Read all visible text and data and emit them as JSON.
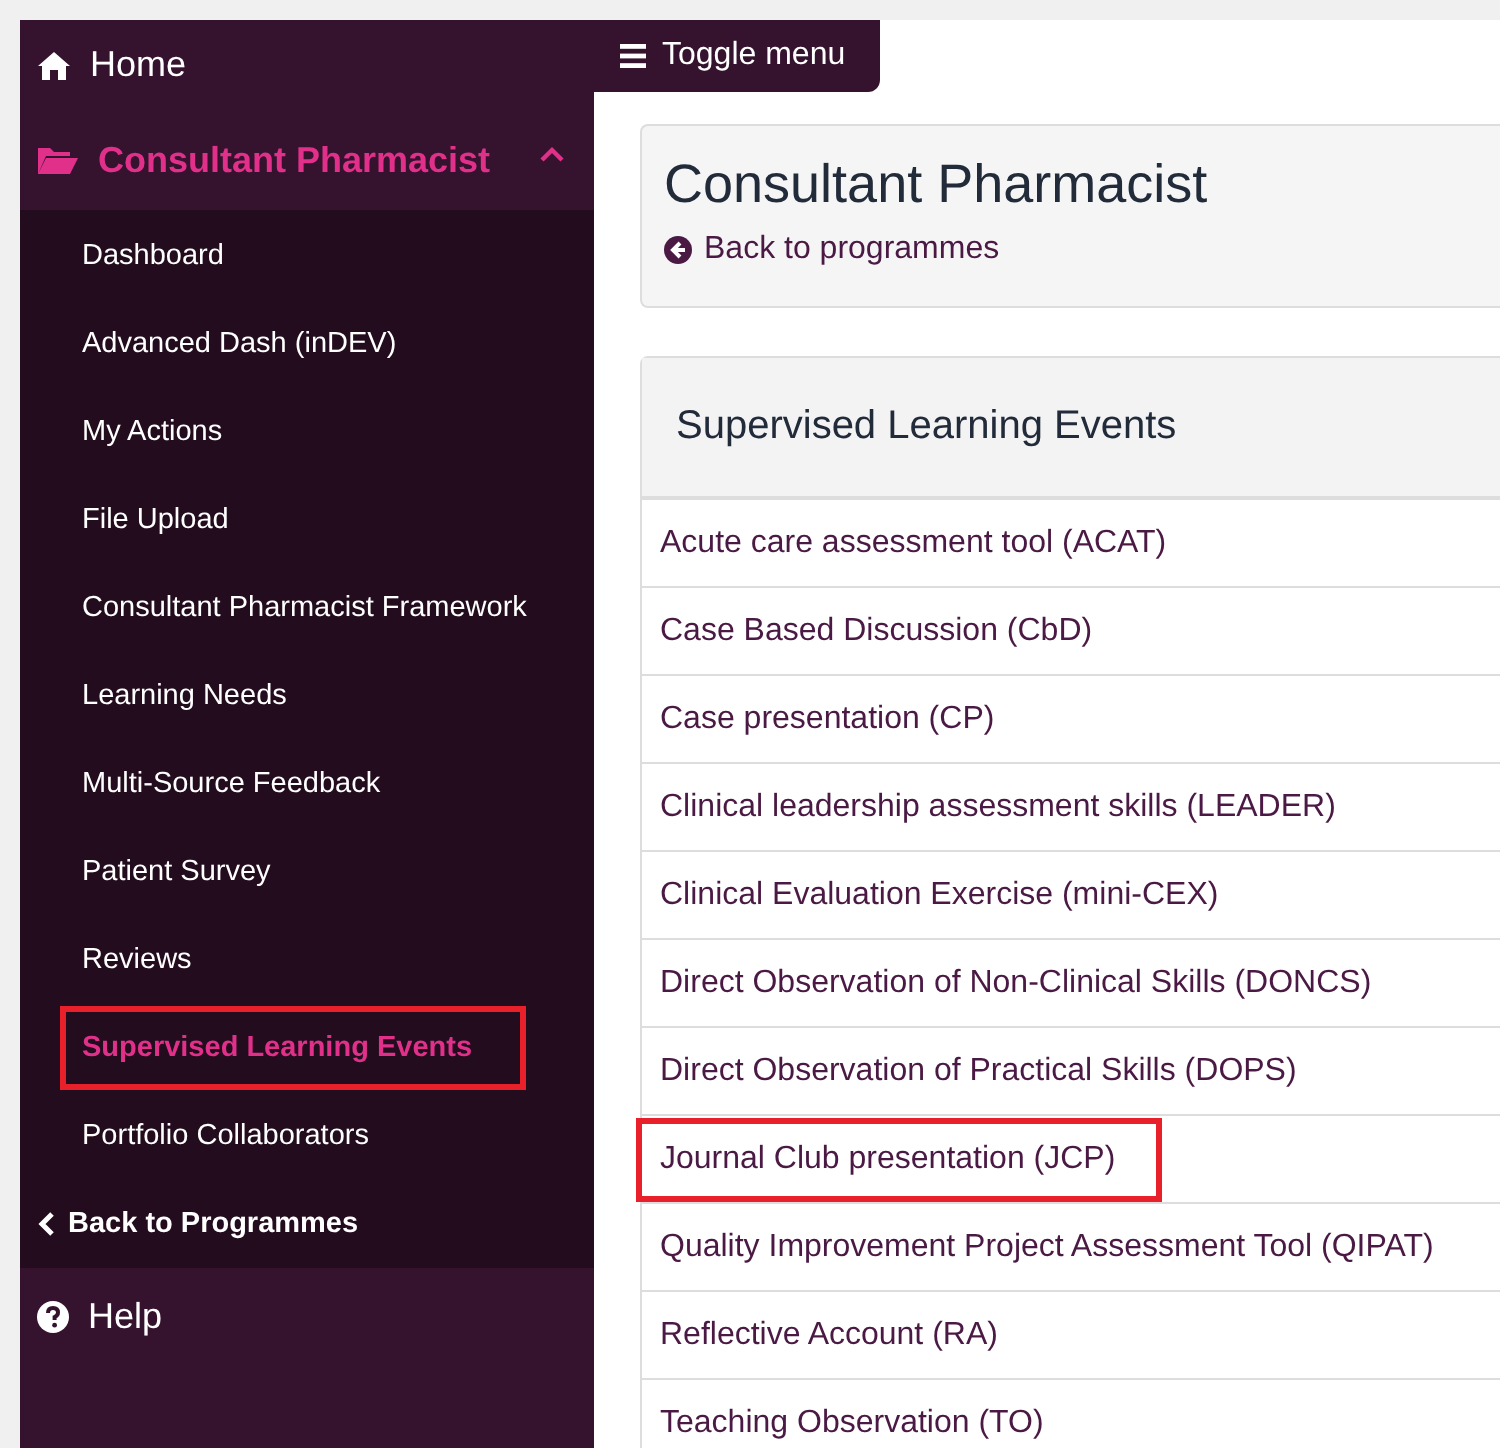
{
  "sidebar": {
    "home": {
      "label": "Home"
    },
    "section": {
      "label": "Consultant Pharmacist",
      "expanded": true
    },
    "items": [
      {
        "label": "Dashboard",
        "selected": false,
        "highlighted": false
      },
      {
        "label": "Advanced Dash (inDEV)",
        "selected": false,
        "highlighted": false
      },
      {
        "label": "My Actions",
        "selected": false,
        "highlighted": false
      },
      {
        "label": "File Upload",
        "selected": false,
        "highlighted": false
      },
      {
        "label": "Consultant Pharmacist Framework",
        "selected": false,
        "highlighted": false
      },
      {
        "label": "Learning Needs",
        "selected": false,
        "highlighted": false
      },
      {
        "label": "Multi-Source Feedback",
        "selected": false,
        "highlighted": false
      },
      {
        "label": "Patient Survey",
        "selected": false,
        "highlighted": false
      },
      {
        "label": "Reviews",
        "selected": false,
        "highlighted": false
      },
      {
        "label": "Supervised Learning Events",
        "selected": true,
        "highlighted": true
      },
      {
        "label": "Portfolio Collaborators",
        "selected": false,
        "highlighted": false
      }
    ],
    "back": {
      "label": "Back to Programmes"
    },
    "help": {
      "label": "Help"
    }
  },
  "toggle": {
    "label": "Toggle menu"
  },
  "header": {
    "title": "Consultant Pharmacist",
    "back_link": "Back to programmes"
  },
  "panel": {
    "title": "Supervised Learning Events",
    "items": [
      {
        "label": "Acute care assessment tool (ACAT)",
        "highlighted": false
      },
      {
        "label": "Case Based Discussion (CbD)",
        "highlighted": false
      },
      {
        "label": "Case presentation (CP)",
        "highlighted": false
      },
      {
        "label": "Clinical leadership assessment skills (LEADER)",
        "highlighted": false
      },
      {
        "label": "Clinical Evaluation Exercise (mini-CEX)",
        "highlighted": false
      },
      {
        "label": "Direct Observation of Non-Clinical Skills (DONCS)",
        "highlighted": false
      },
      {
        "label": "Direct Observation of Practical Skills (DOPS)",
        "highlighted": false
      },
      {
        "label": "Journal Club presentation (JCP)",
        "highlighted": true
      },
      {
        "label": "Quality Improvement Project Assessment Tool (QIPAT)",
        "highlighted": false
      },
      {
        "label": "Reflective Account (RA)",
        "highlighted": false
      },
      {
        "label": "Teaching Observation (TO)",
        "highlighted": false
      }
    ]
  }
}
